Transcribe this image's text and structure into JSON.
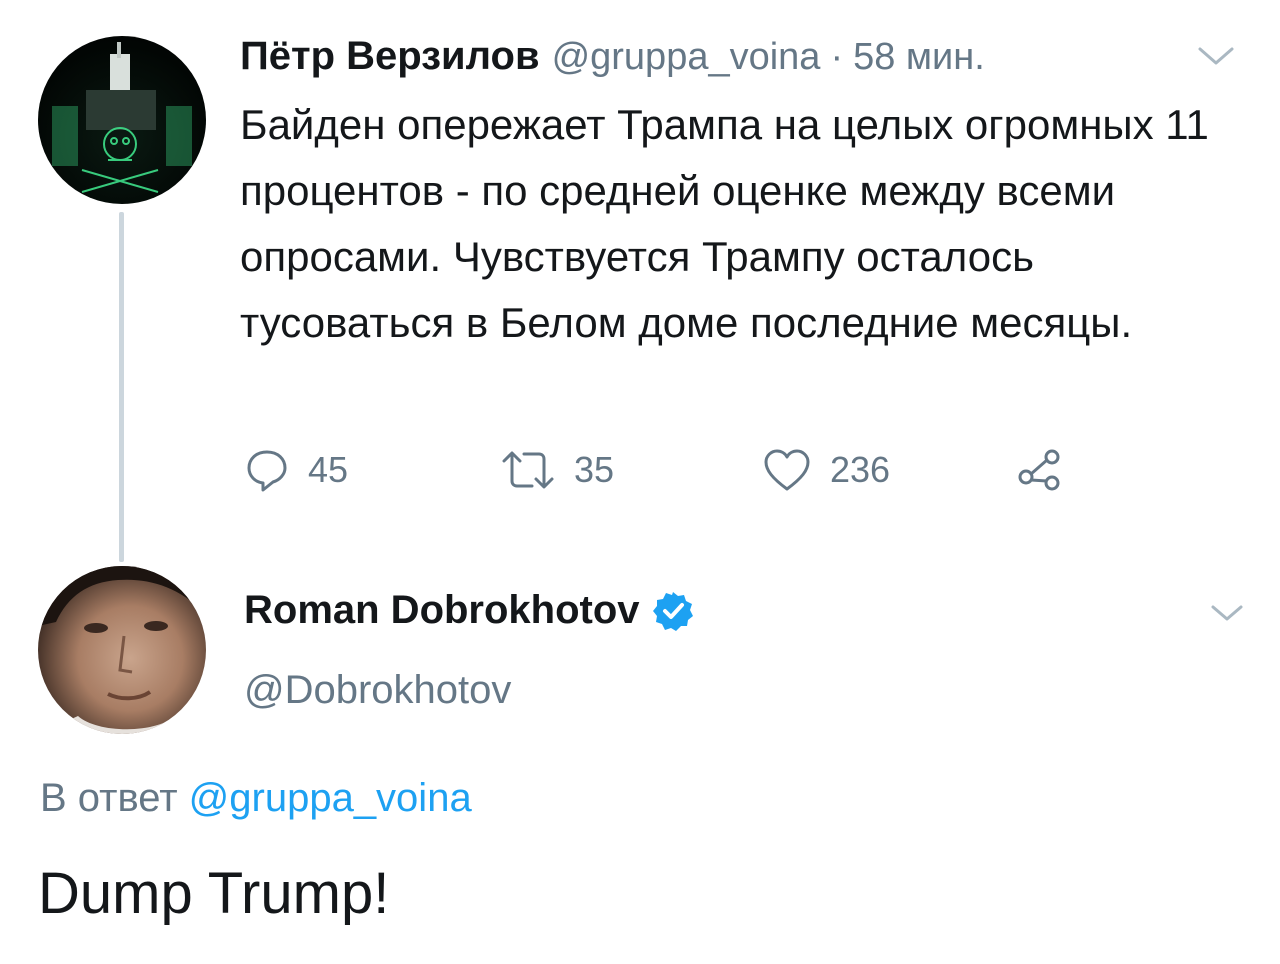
{
  "tweet1": {
    "author_name": "Пётр Верзилов",
    "handle": "@gruppa_voina",
    "separator": "·",
    "time": "58 мин.",
    "text": "Байден опережает Трампа на целых огромных 11 процентов - по средней оценке между всеми опросами. Чувствуется Трампу осталось тусоваться в Белом доме последние месяцы.",
    "actions": {
      "reply_count": "45",
      "retweet_count": "35",
      "like_count": "236"
    },
    "icons": [
      "reply-icon",
      "retweet-icon",
      "like-icon",
      "share-icon",
      "chevron-down-icon"
    ]
  },
  "tweet2": {
    "author_name": "Roman Dobrokhotov",
    "verified": true,
    "handle": "@Dobrokhotov",
    "reply_prefix": "В ответ",
    "reply_to": "@gruppa_voina",
    "text": "Dump Trump!",
    "icons": [
      "verified-badge-icon",
      "chevron-down-icon"
    ]
  },
  "colors": {
    "text_primary": "#14171a",
    "text_secondary": "#657786",
    "link_blue": "#1da1f2",
    "thread_line": "#ccd6dd"
  }
}
